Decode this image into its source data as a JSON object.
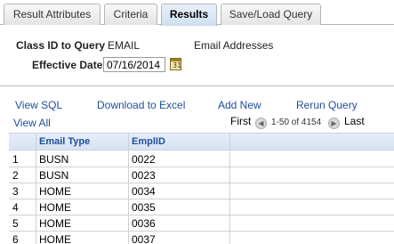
{
  "tabs": [
    {
      "label": "Result Attributes"
    },
    {
      "label": "Criteria"
    },
    {
      "label": "Results"
    },
    {
      "label": "Save/Load Query"
    }
  ],
  "form": {
    "class_id_label": "Class ID to Query",
    "class_id_value": "EMAIL",
    "class_description": "Email Addresses",
    "effective_date_label": "Effective Date",
    "effective_date_value": "07/16/2014",
    "calendar_glyph": "31"
  },
  "actions": {
    "view_sql": "View SQL",
    "download_excel": "Download to Excel",
    "add_new": "Add New",
    "rerun_query": "Rerun Query",
    "view_all": "View All",
    "first": "First",
    "last": "Last",
    "range": "1-50 of 4154"
  },
  "grid": {
    "columns": [
      "",
      "Email Type",
      "EmplID"
    ],
    "rows": [
      [
        "1",
        "BUSN",
        "0022"
      ],
      [
        "2",
        "BUSN",
        "0023"
      ],
      [
        "3",
        "HOME",
        "0034"
      ],
      [
        "4",
        "HOME",
        "0035"
      ],
      [
        "5",
        "HOME",
        "0036"
      ],
      [
        "6",
        "HOME",
        "0037"
      ]
    ]
  }
}
